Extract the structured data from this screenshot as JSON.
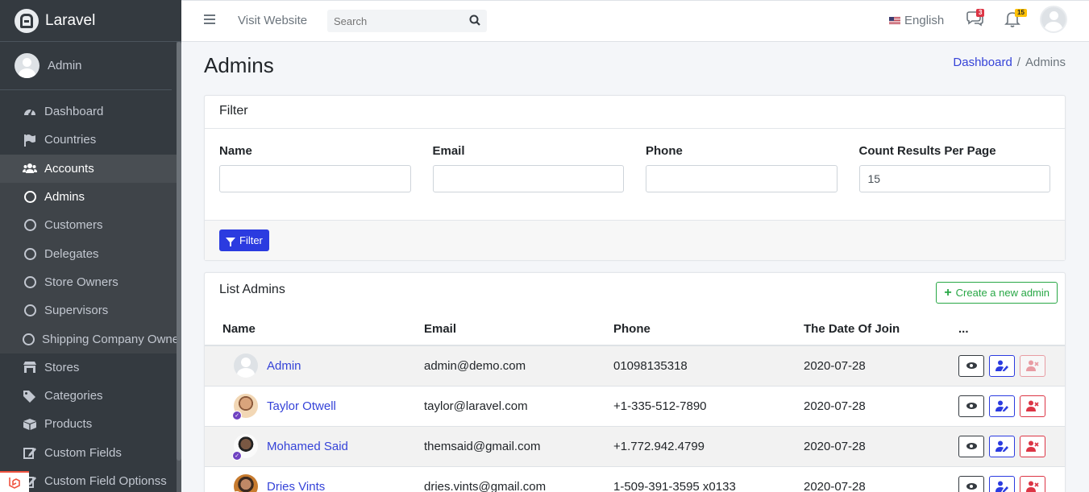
{
  "brand": {
    "name": "Laravel"
  },
  "user": {
    "name": "Admin"
  },
  "sidebar": {
    "items": [
      {
        "label": "Dashboard",
        "icon": "tachometer-icon"
      },
      {
        "label": "Countries",
        "icon": "flag-icon"
      },
      {
        "label": "Accounts",
        "icon": "users-icon"
      },
      {
        "label": "Admins",
        "icon": "circle-icon"
      },
      {
        "label": "Customers",
        "icon": "circle-icon"
      },
      {
        "label": "Delegates",
        "icon": "circle-icon"
      },
      {
        "label": "Store Owners",
        "icon": "circle-icon"
      },
      {
        "label": "Supervisors",
        "icon": "circle-icon"
      },
      {
        "label": "Shipping Company Owner",
        "icon": "circle-icon"
      },
      {
        "label": "Stores",
        "icon": "store-icon"
      },
      {
        "label": "Categories",
        "icon": "tags-icon"
      },
      {
        "label": "Products",
        "icon": "box-icon"
      },
      {
        "label": "Custom Fields",
        "icon": "edit-icon"
      },
      {
        "label": "Custom Field Optionss",
        "icon": "edit-icon"
      }
    ]
  },
  "navbar": {
    "visit_label": "Visit Website",
    "search_placeholder": "Search",
    "language": "English",
    "messages_count": "3",
    "notifications_count": "15"
  },
  "page": {
    "title": "Admins",
    "breadcrumb": {
      "home": "Dashboard",
      "current": "Admins"
    }
  },
  "filter": {
    "title": "Filter",
    "fields": [
      {
        "label": "Name",
        "value": ""
      },
      {
        "label": "Email",
        "value": ""
      },
      {
        "label": "Phone",
        "value": ""
      },
      {
        "label": "Count Results Per Page",
        "value": "15"
      }
    ],
    "button_label": "Filter"
  },
  "list": {
    "title": "List Admins",
    "create_label": "Create a new admin",
    "columns": [
      "Name",
      "Email",
      "Phone",
      "The Date Of Join",
      "..."
    ],
    "rows": [
      {
        "name": "Admin",
        "email": "admin@demo.com",
        "phone": "01098135318",
        "joined": "2020-07-28"
      },
      {
        "name": "Taylor Otwell",
        "email": "taylor@laravel.com",
        "phone": "+1-335-512-7890",
        "joined": "2020-07-28"
      },
      {
        "name": "Mohamed Said",
        "email": "themsaid@gmail.com",
        "phone": "+1.772.942.4799",
        "joined": "2020-07-28"
      },
      {
        "name": "Dries Vints",
        "email": "dries.vints@gmail.com",
        "phone": "1-509-391-3595 x0133",
        "joined": "2020-07-28"
      }
    ]
  },
  "colors": {
    "sidebar_bg": "#343a40",
    "primary": "#2b3be0",
    "success": "#28a745",
    "danger": "#dc3545",
    "verified": "#6f42c1"
  }
}
